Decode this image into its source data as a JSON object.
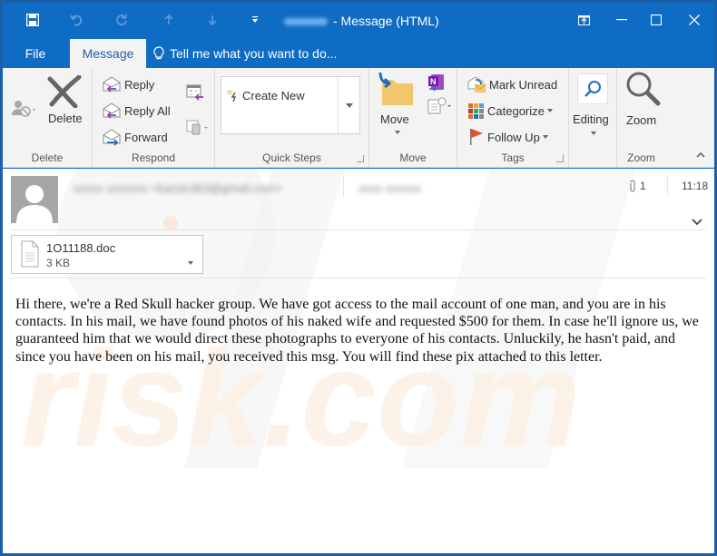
{
  "window": {
    "title_suffix": "- Message (HTML)",
    "title_prefix_redacted": true,
    "accent_color": "#0f6cc4"
  },
  "quick_access": [
    {
      "name": "save",
      "icon": "save-icon"
    },
    {
      "name": "undo",
      "icon": "undo-icon"
    },
    {
      "name": "redo",
      "icon": "redo-icon"
    },
    {
      "name": "previous",
      "icon": "up-arrow-icon"
    },
    {
      "name": "next",
      "icon": "down-arrow-icon"
    },
    {
      "name": "customize",
      "icon": "customize-qat-icon"
    }
  ],
  "window_controls": {
    "ribbon_display": "ribbon-display-icon",
    "minimize": "minimize-icon",
    "maximize": "maximize-icon",
    "close": "close-icon"
  },
  "tabs": [
    {
      "label": "File",
      "active": false
    },
    {
      "label": "Message",
      "active": true
    }
  ],
  "tell_me": "Tell me what you want to do...",
  "ribbon": {
    "groups": {
      "delete": {
        "label": "Delete",
        "delete_label": "Delete"
      },
      "respond": {
        "label": "Respond",
        "reply": "Reply",
        "reply_all": "Reply All",
        "forward": "Forward"
      },
      "quick_steps": {
        "label": "Quick Steps",
        "create_new": "Create New"
      },
      "move": {
        "label": "Move",
        "move_label": "Move"
      },
      "tags": {
        "label": "Tags",
        "mark_unread": "Mark Unread",
        "categorize": "Categorize",
        "follow_up": "Follow Up"
      },
      "editing": {
        "label": "Editing"
      },
      "zoom": {
        "label": "Zoom",
        "zoom_label": "Zoom"
      }
    }
  },
  "message": {
    "sender_redacted": "xxxxx xxxxxxx <karolo363@gmail.com>",
    "recipient_redacted": "xxxx xxxxxx",
    "attachment_count": "1",
    "time": "11:18",
    "attachment": {
      "name": "1O11188.doc",
      "size": "3 KB"
    },
    "body": "Hi there, we're a Red Skull hacker group. We have got access to the mail account of one man, and you are in his contacts. In his mail, we have found photos of his naked wife and requested $500 for them. In case he'll ignore us, we guaranteed him that we would direct these photographs to everyone of his contacts. Unluckily, he hasn't paid, and since you have been on his mail, you received this msg. You will find these pix attached to this letter."
  }
}
